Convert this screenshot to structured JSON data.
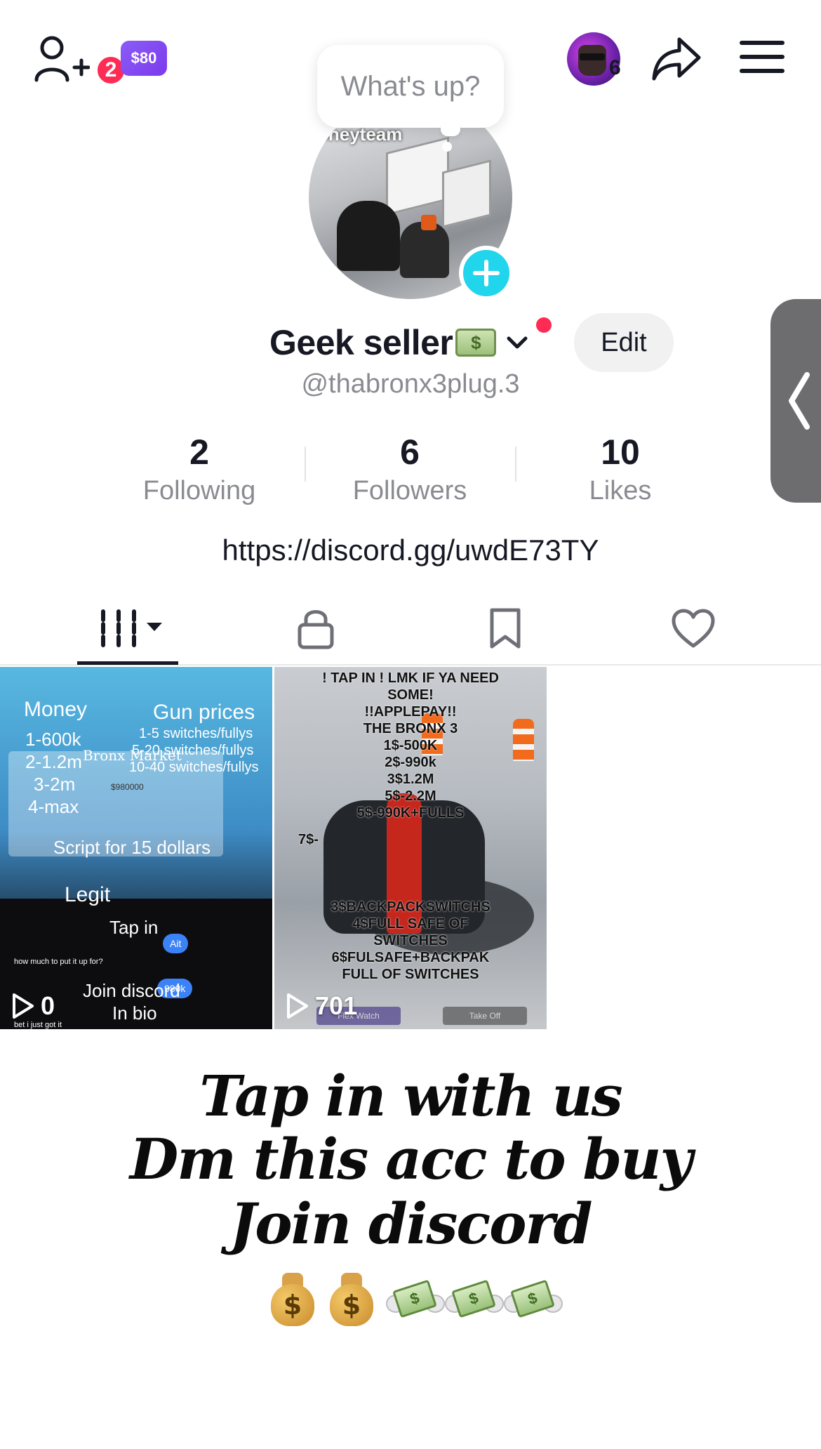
{
  "header": {
    "notification_count": "2",
    "coins_label": "$80",
    "story_count": "6"
  },
  "profile": {
    "status_prompt": "What's up?",
    "avatar_caption": "oneyteam",
    "display_name": "Geek seller",
    "edit_label": "Edit",
    "username": "@thabronx3plug.3",
    "bio_link": "https://discord.gg/uwdE73TY"
  },
  "stats": [
    {
      "value": "2",
      "label": "Following"
    },
    {
      "value": "6",
      "label": "Followers"
    },
    {
      "value": "10",
      "label": "Likes"
    }
  ],
  "tabs": [
    {
      "icon": "videos-grid-icon",
      "active": true
    },
    {
      "icon": "lock-icon",
      "active": false
    },
    {
      "icon": "bookmark-icon",
      "active": false
    },
    {
      "icon": "heart-icon",
      "active": false
    }
  ],
  "videos": [
    {
      "views": "0",
      "overlay": {
        "title_left": "Money",
        "title_right": "Gun prices",
        "lines_left": [
          "1-600k",
          "2-1.2m",
          "3-2m",
          "4-max"
        ],
        "lines_right": [
          "1-5 switches/fullys",
          "5-20 switches/fullys",
          "10-40 switches/fullys"
        ],
        "market": "Bronx Market",
        "amount": "$980000",
        "script": "Script for 15 dollars",
        "legit": "Legit",
        "tap": "Tap in",
        "chat": "how much to put it up for?",
        "chat2": "bet i just got it",
        "join": "Join discord",
        "bio": "In bio",
        "chip1": "Ait",
        "chip2": "980k"
      }
    },
    {
      "views": "701",
      "overlay": {
        "lines": [
          "! TAP IN ! LMK IF YA NEED",
          "SOME!",
          "!!APPLEPAY!!",
          "THE BRONX 3",
          "1$-500K",
          "2$-990k",
          "3$1.2M",
          "5$-2.2M",
          "5$-990K+FULLS",
          "7$-",
          "3$BACKPACKSWITCHS",
          "4$FULL SAFE OF",
          "SWITCHES",
          "6$FULSAFE+BACKPAK",
          "FULL OF SWITCHES"
        ],
        "btn_left": "Flex Watch",
        "btn_right": "Take Off"
      }
    }
  ],
  "bio_text": {
    "line1": "Tap in with us",
    "line2": "Dm this acc to buy",
    "line3": "Join discord"
  },
  "icons": {
    "add_friend": "add-friend-icon",
    "share": "share-icon",
    "menu": "hamburger-menu-icon",
    "drawer": "chevron-left-icon"
  },
  "colors": {
    "accent_red": "#fe2c55",
    "accent_cyan": "#20d5ec",
    "coins_purple": "#7c3aed",
    "muted_text": "#8a8b91"
  }
}
